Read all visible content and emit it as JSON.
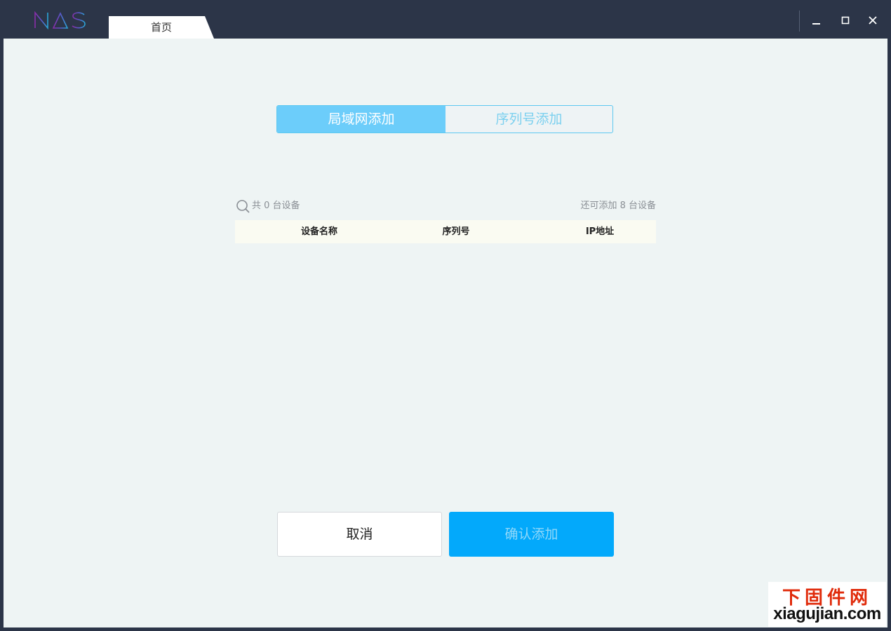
{
  "app": {
    "logo_text": "NAS"
  },
  "tabs": [
    {
      "label": "首页"
    }
  ],
  "window_controls": [
    "minimize-icon",
    "maximize-icon",
    "close-icon"
  ],
  "segmented": {
    "lan_label": "局域网添加",
    "serial_label": "序列号添加",
    "active": "lan"
  },
  "device_list": {
    "count_text": "共 0 台设备",
    "remaining_text": "还可添加 8 台设备",
    "columns": [
      "设备名称",
      "序列号",
      "IP地址"
    ],
    "rows": []
  },
  "buttons": {
    "cancel": "取消",
    "confirm": "确认添加"
  },
  "watermark": {
    "cn": "下固件网",
    "en": "xiagujian.com"
  },
  "colors": {
    "titlebar": "#2c3548",
    "content_bg": "#eef4f4",
    "accent": "#03a9fb",
    "segment_active": "#6ccdfa"
  }
}
